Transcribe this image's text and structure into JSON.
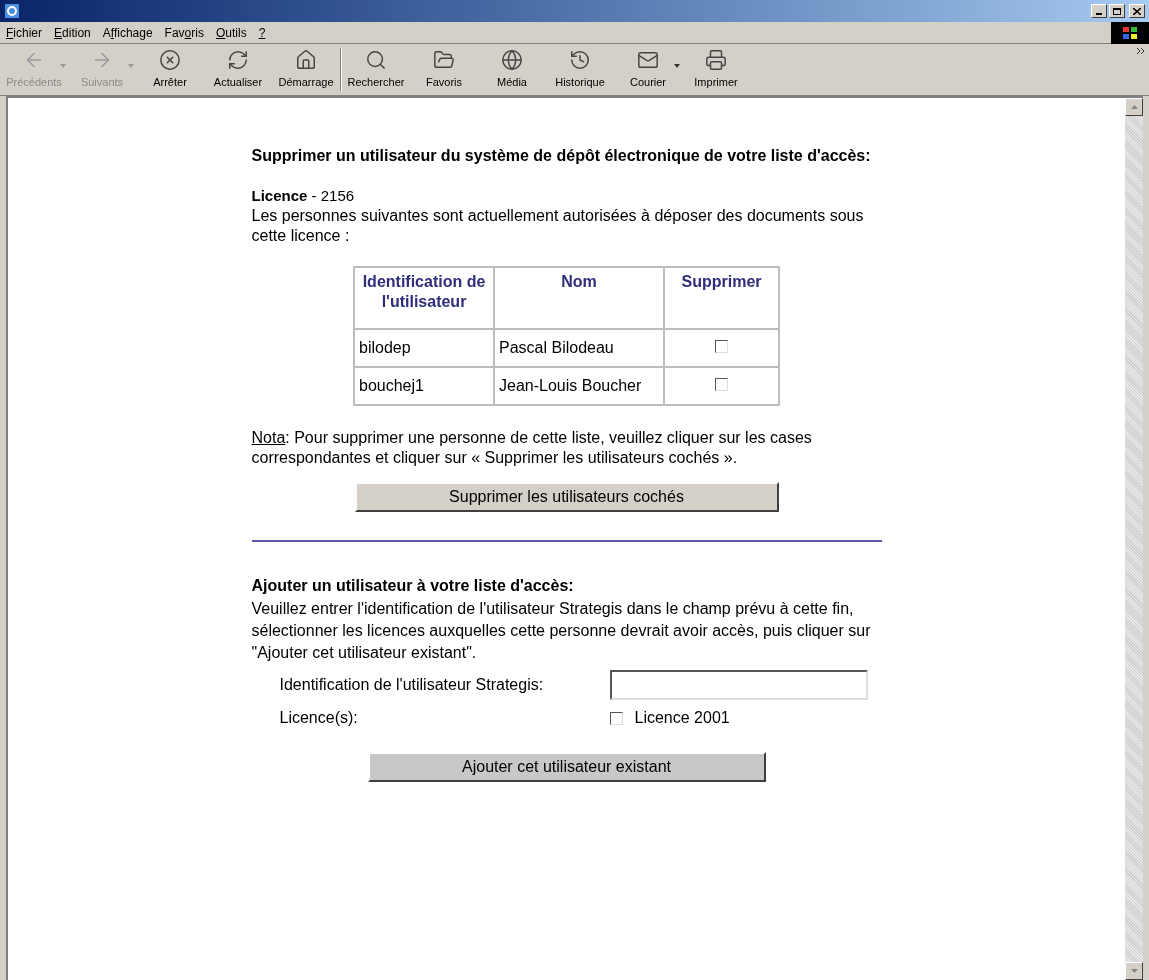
{
  "menu": [
    {
      "mnemonic": "F",
      "rest": "ichier"
    },
    {
      "mnemonic": "E",
      "rest": "dition"
    },
    {
      "lead": "A",
      "mnemonic": "f",
      "rest": "fichage"
    },
    {
      "lead": "Fav",
      "mnemonic": "o",
      "rest": "ris"
    },
    {
      "mnemonic": "O",
      "rest": "utils"
    },
    {
      "mnemonic": "?"
    }
  ],
  "toolbar_groups": [
    [
      {
        "label": "Précédents",
        "kind": "back",
        "disabled": true,
        "dropdown": true
      },
      {
        "label": "Suivants",
        "kind": "forward",
        "disabled": true,
        "dropdown": true
      },
      {
        "label": "Arrêter",
        "kind": "stop",
        "disabled": false,
        "dropdown": false
      },
      {
        "label": "Actualiser",
        "kind": "refresh",
        "disabled": false,
        "dropdown": false
      },
      {
        "label": "Démarrage",
        "kind": "home",
        "disabled": false,
        "dropdown": false
      }
    ],
    [
      {
        "label": "Rechercher",
        "kind": "search",
        "disabled": false,
        "dropdown": false
      },
      {
        "label": "Favoris",
        "kind": "favorites",
        "disabled": false,
        "dropdown": false
      },
      {
        "label": "Média",
        "kind": "media",
        "disabled": false,
        "dropdown": false
      },
      {
        "label": "Historique",
        "kind": "history",
        "disabled": false,
        "dropdown": false
      },
      {
        "label": "Courier",
        "kind": "mail",
        "disabled": false,
        "dropdown": true
      },
      {
        "label": "Imprimer",
        "kind": "print",
        "disabled": false,
        "dropdown": false
      }
    ]
  ],
  "remove_section": {
    "heading": "Supprimer un utilisateur du système de dépôt électronique de votre liste d'accès:",
    "licence": "**Licence** - 2156",
    "intro": "Les personnes suivantes sont actuellement autorisées à déposer des documents sous cette licence :",
    "table": {
      "columns": [
        "Identification de l'utilisateur",
        "Nom",
        "Supprimer"
      ],
      "rows": [
        {
          "id": "bilodep",
          "name": "Pascal Bilodeau",
          "checked": false
        },
        {
          "id": "bouchej1",
          "name": "Jean-Louis Boucher",
          "checked": false
        }
      ]
    },
    "nota_label": "Nota",
    "nota_text": ": Pour supprimer une personne de cette liste, veuillez cliquer sur les cases correspondantes et cliquer sur « Supprimer les utilisateurs cochés ».",
    "button": "Supprimer les utilisateurs cochés"
  },
  "add_section": {
    "heading": "Ajouter un utilisateur à votre liste d'accès:",
    "intro": "Veuillez entrer l'identification de l'utilisateur Strategis dans le champ prévu à cette fin, sélectionner les licences auxquelles cette personne devrait avoir accès, puis cliquer sur \"Ajouter cet utilisateur existant\".",
    "id_label": "Identification de l'utilisateur Strategis:",
    "licences_label": "Licence(s):",
    "licences": [
      {
        "label": "Licence 2001",
        "checked": false
      }
    ],
    "button": "Ajouter cet utilisateur existant"
  }
}
